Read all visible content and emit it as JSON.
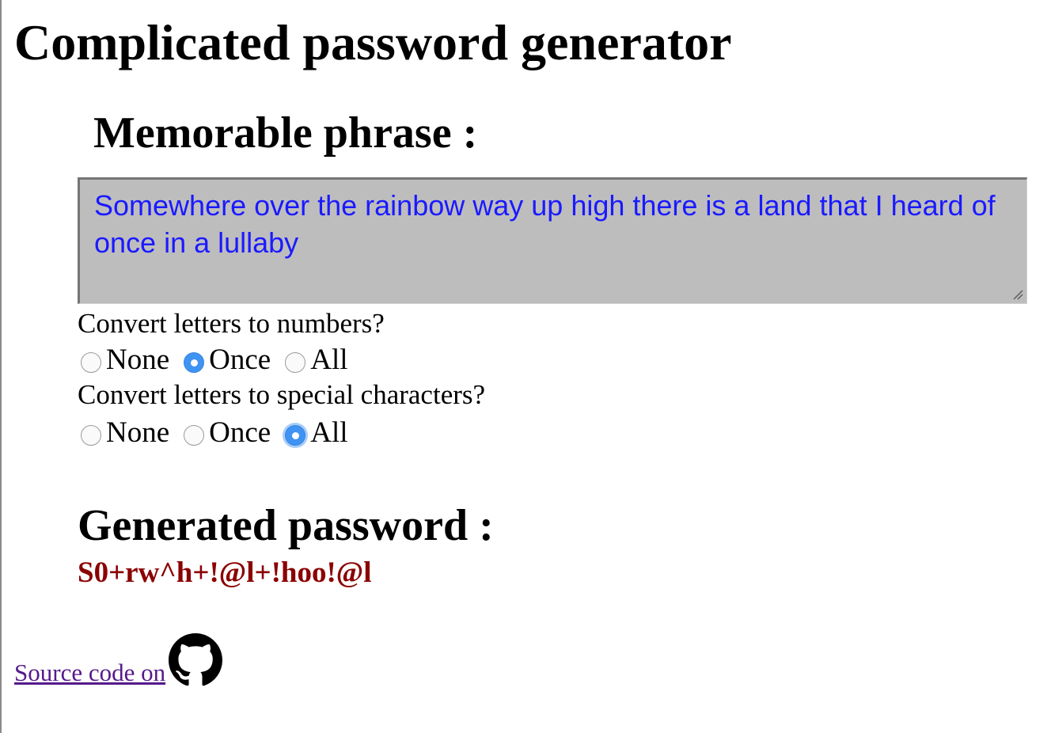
{
  "title": "Complicated password generator",
  "phrase_section": {
    "heading": "Memorable phrase :",
    "value": "Somewhere over the rainbow way up high there is a land that I heard of once in a lullaby"
  },
  "numbers_option": {
    "question": "Convert letters to numbers?",
    "options": [
      "None",
      "Once",
      "All"
    ],
    "selected": "Once"
  },
  "special_option": {
    "question": "Convert letters to special characters?",
    "options": [
      "None",
      "Once",
      "All"
    ],
    "selected": "All"
  },
  "result": {
    "heading": "Generated password :",
    "password": "S0+rw^h+!@l+!hoo!@l"
  },
  "footer": {
    "link_text": "Source code on ",
    "icon": "github-icon"
  },
  "colors": {
    "textarea_bg": "#bebdbe",
    "textarea_text": "#1a1aff",
    "password_text": "#8b0000",
    "link_visited": "#551a8b",
    "radio_accent": "#3f93f3"
  }
}
